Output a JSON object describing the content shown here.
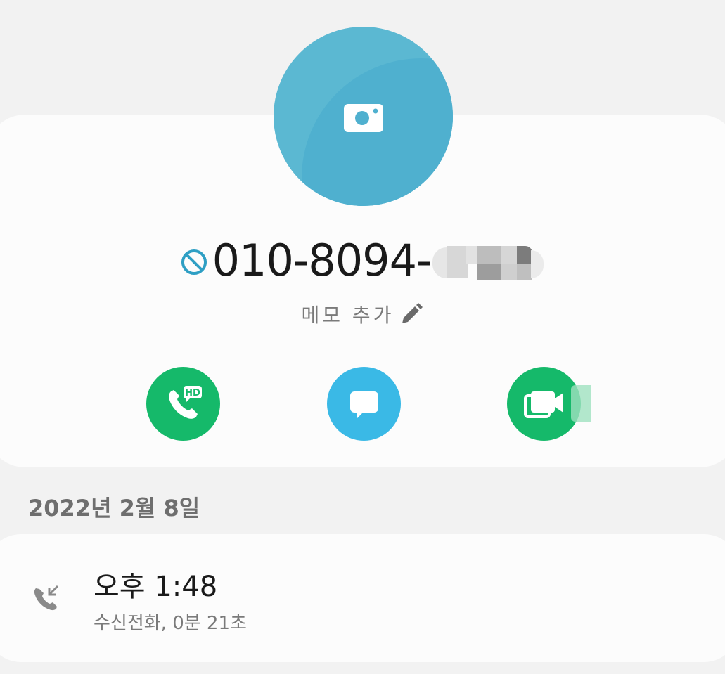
{
  "contact": {
    "number_visible": "010-8094-",
    "add_memo_label": "메모 추가"
  },
  "icons": {
    "avatar": "camera-icon",
    "blocked": "block-icon",
    "memo": "pencil-icon",
    "call": "hd-voice-call-icon",
    "message": "message-icon",
    "video": "video-call-icon",
    "log": "incoming-call-icon"
  },
  "call_log": {
    "date": "2022년 2월 8일",
    "entries": [
      {
        "time": "오후 1:48",
        "detail": "수신전화, 0분 21초"
      }
    ]
  },
  "colors": {
    "avatar": "#5bb8d2",
    "call_green": "#15b96a",
    "message_blue": "#3ab9e6",
    "block_icon": "#2e9fc4"
  }
}
